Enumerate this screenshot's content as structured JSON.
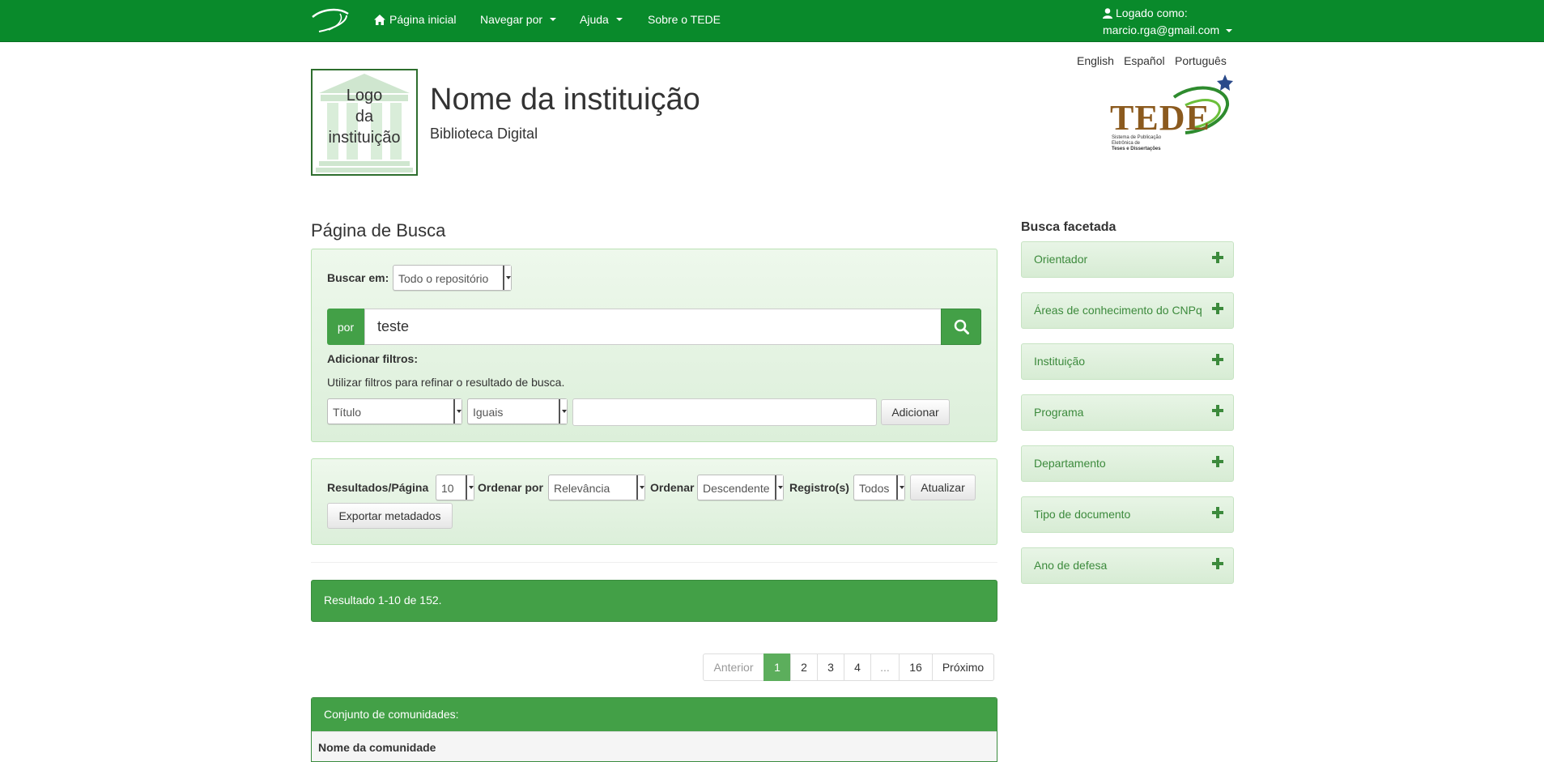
{
  "navbar": {
    "home": "Página inicial",
    "browse": "Navegar por",
    "help": "Ajuda",
    "about": "Sobre o TEDE",
    "logged_as": "Logado como:",
    "user_email": "marcio.rga@gmail.com"
  },
  "languages": [
    "English",
    "Español",
    "Português"
  ],
  "header": {
    "institution_name": "Nome da instituição",
    "subtitle": "Biblioteca Digital",
    "logo_lines": [
      "Logo",
      "da",
      "instituição"
    ],
    "tede_brand": "TEDE",
    "tede_tagline": [
      "Sistema de Publicação",
      "Eletrônica de",
      "Teses e Dissertações"
    ]
  },
  "search": {
    "page_title": "Página de Busca",
    "scope_label": "Buscar em:",
    "scope_value": "Todo o repositório",
    "by_label": "por",
    "query": "teste",
    "add_filters_label": "Adicionar filtros:",
    "filters_help": "Utilizar filtros para refinar o resultado de busca.",
    "filter_field": "Título",
    "filter_op": "Iguais",
    "filter_value": "",
    "add_button": "Adicionar"
  },
  "options": {
    "rpp_label": "Resultados/Página",
    "rpp_value": "10",
    "sort_by_label": "Ordenar por",
    "sort_by_value": "Relevância",
    "order_label": "Ordenar",
    "order_value": "Descendente",
    "records_label": "Registro(s)",
    "records_value": "Todos",
    "update_button": "Atualizar",
    "export_button": "Exportar metadados"
  },
  "results": {
    "summary": "Resultado 1-10 de 152.",
    "pager": [
      "Anterior",
      "1",
      "2",
      "3",
      "4",
      "...",
      "16",
      "Próximo"
    ],
    "active_page": "1",
    "communities_header": "Conjunto de comunidades:",
    "community_column": "Nome da comunidade"
  },
  "facets": {
    "title": "Busca facetada",
    "items": [
      "Orientador",
      "Áreas de conhecimento do CNPq",
      "Instituição",
      "Programa",
      "Departamento",
      "Tipo de documento",
      "Ano de defesa"
    ]
  },
  "colors": {
    "navbar": "#098a2b",
    "accent": "#43a047",
    "facet_text": "#3c8a3c"
  }
}
